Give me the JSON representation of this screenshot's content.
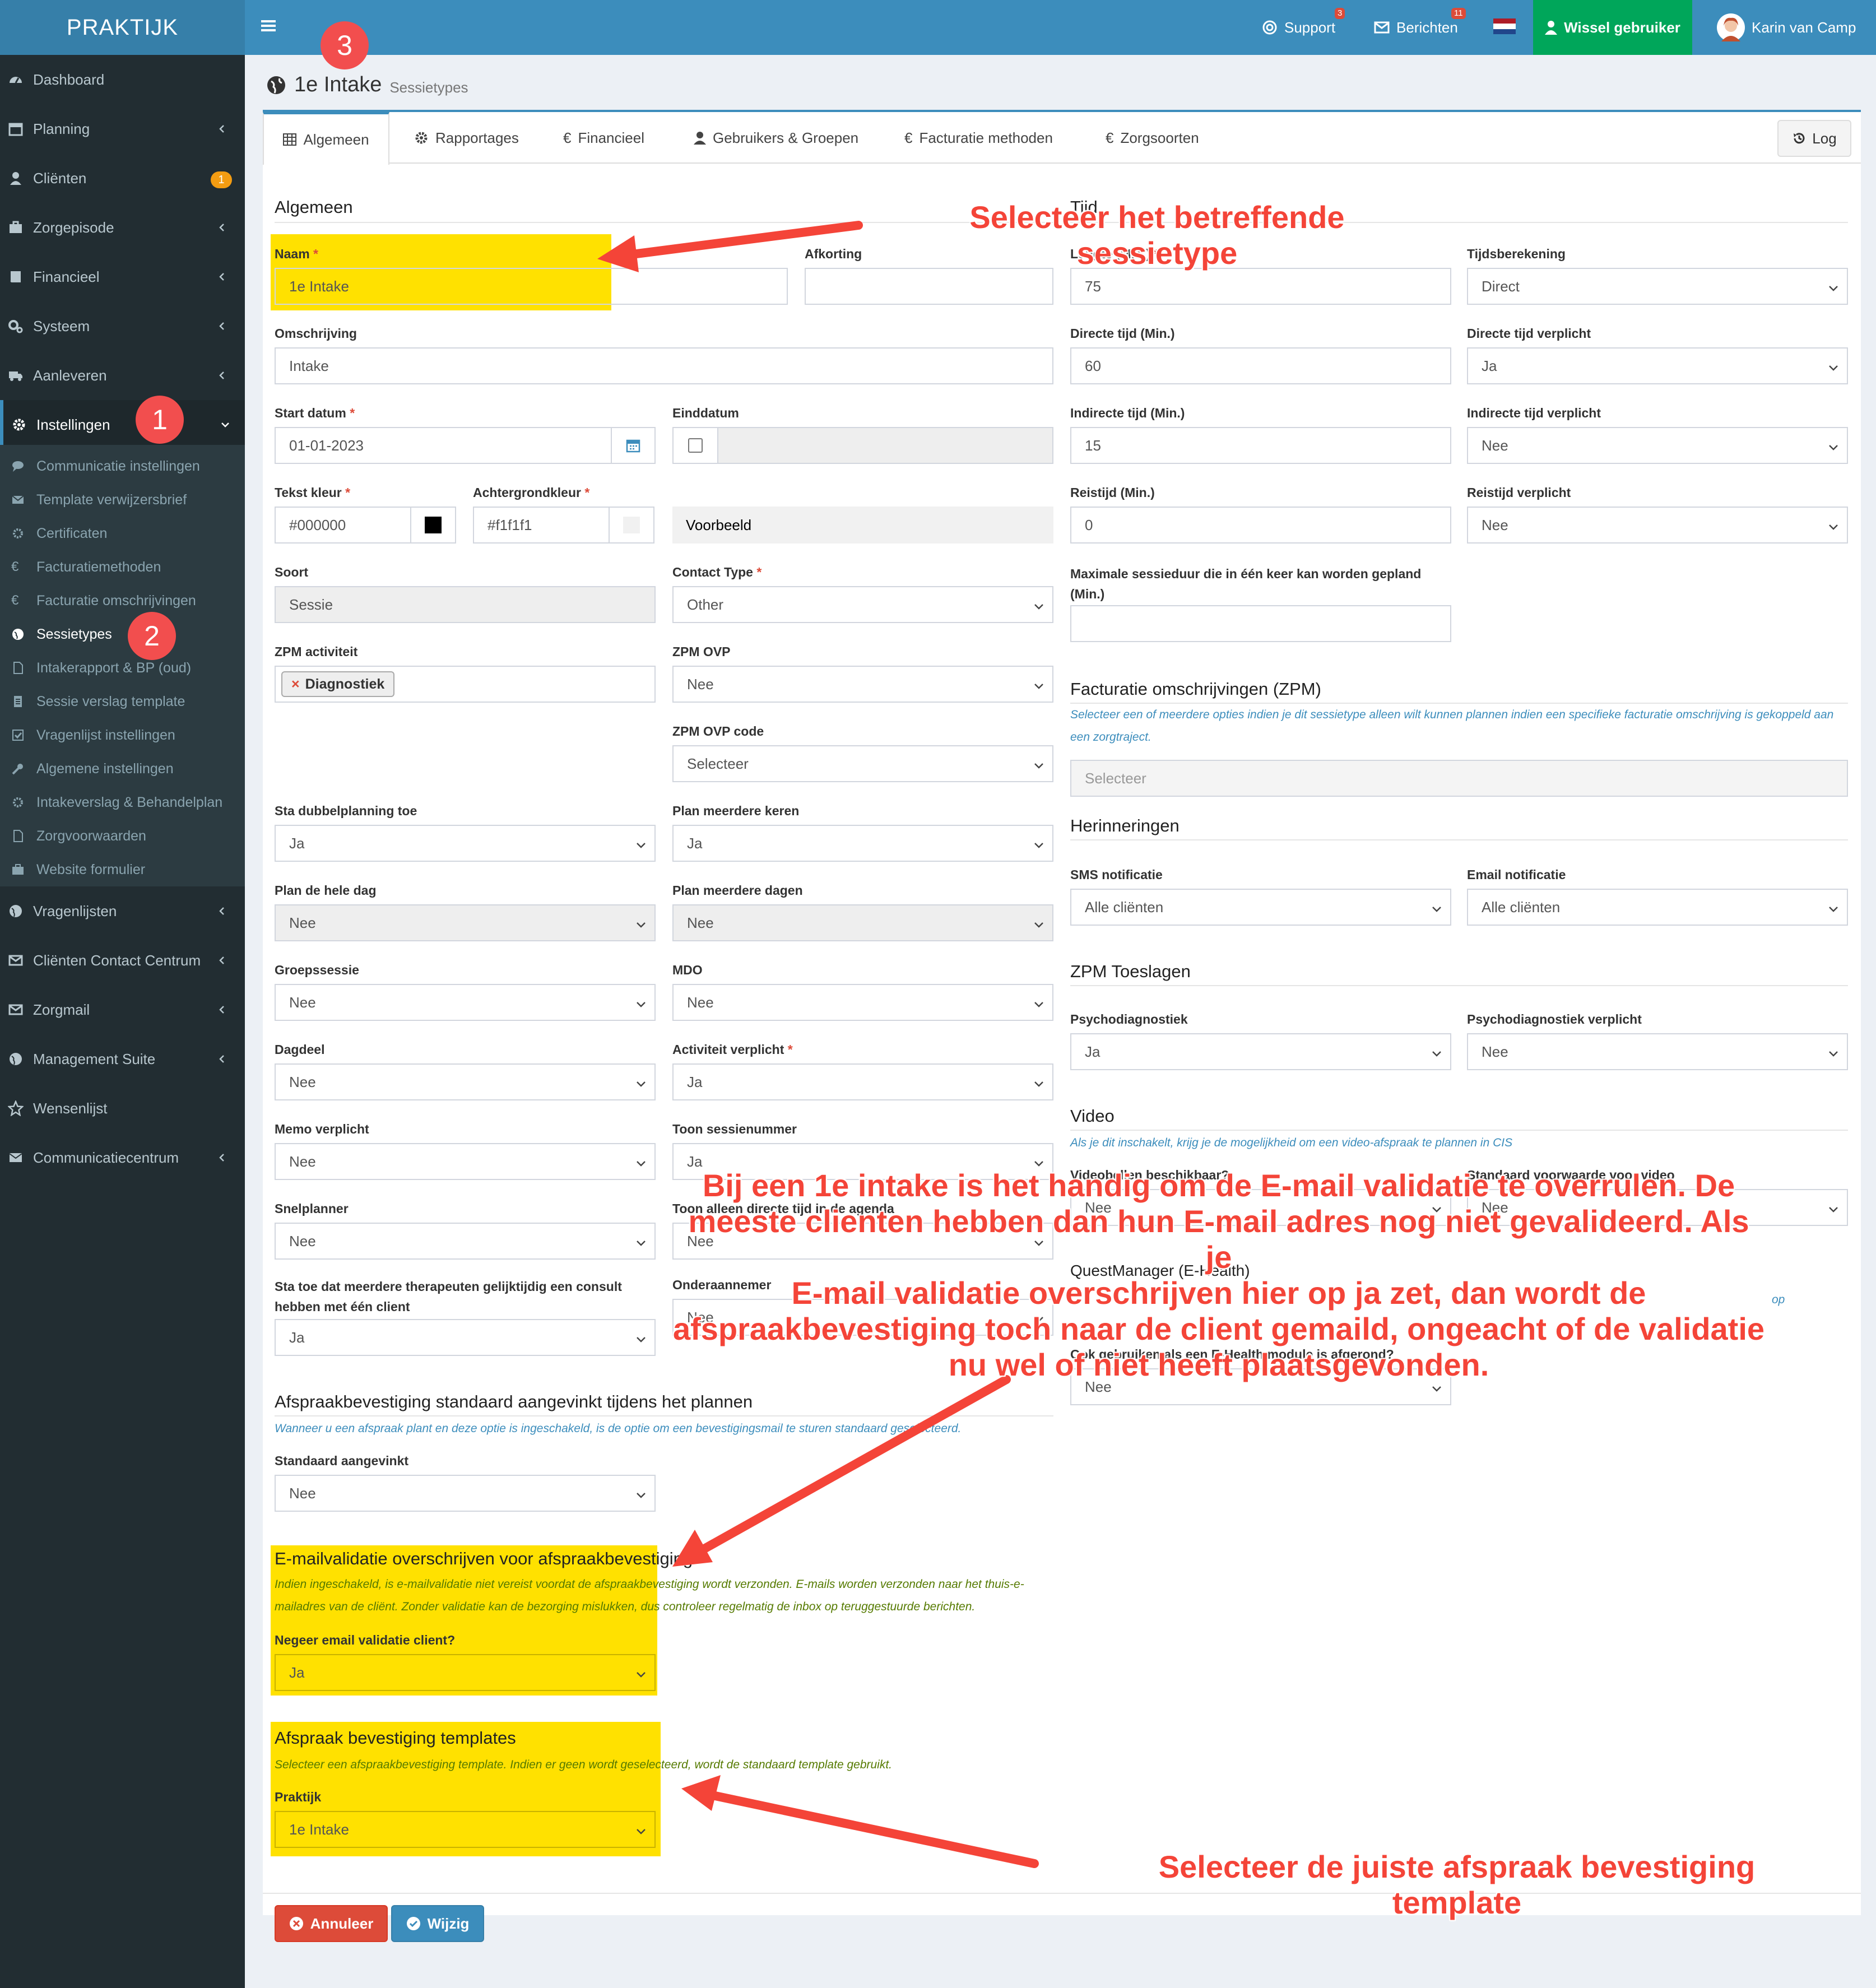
{
  "topbar": {
    "brand": "PRAKTIJK",
    "support_label": "Support",
    "support_badge": "3",
    "berichten_label": "Berichten",
    "berichten_badge": "11",
    "wissel_label": "Wissel gebruiker",
    "user_name": "Karin van Camp"
  },
  "sidebar": {
    "items": [
      {
        "label": "Dashboard",
        "icon": "dashboard-icon"
      },
      {
        "label": "Planning",
        "icon": "calendar-icon"
      },
      {
        "label": "Cliënten",
        "icon": "user-icon",
        "badge": "1"
      },
      {
        "label": "Zorgepisode",
        "icon": "briefcase-icon"
      },
      {
        "label": "Financieel",
        "icon": "book-icon"
      },
      {
        "label": "Systeem",
        "icon": "cogs-icon"
      },
      {
        "label": "Aanleveren",
        "icon": "truck-icon"
      },
      {
        "label": "Instellingen",
        "icon": "gear-icon"
      },
      {
        "label": "Vragenlijsten",
        "icon": "globe-icon"
      },
      {
        "label": "Cliënten Contact Centrum",
        "icon": "envelope-icon"
      },
      {
        "label": "Zorgmail",
        "icon": "envelope-icon"
      },
      {
        "label": "Management Suite",
        "icon": "globe-icon"
      },
      {
        "label": "Wensenlijst",
        "icon": "star-icon"
      },
      {
        "label": "Communicatiecentrum",
        "icon": "envelope-icon"
      }
    ],
    "submenu": [
      "Communicatie instellingen",
      "Template verwijzersbrief",
      "Certificaten",
      "Facturatiemethoden",
      "Facturatie omschrijvingen",
      "Sessietypes",
      "Intakerapport & BP (oud)",
      "Sessie verslag template",
      "Vragenlijst instellingen",
      "Algemene instellingen",
      "Intakeverslag & Behandelplan",
      "Zorgvoorwaarden",
      "Website formulier"
    ]
  },
  "page": {
    "title": "1e Intake",
    "subtitle": "Sessietypes"
  },
  "tabs": [
    "Algemeen",
    "Rapportages",
    "Financieel",
    "Gebruikers & Groepen",
    "Facturatie methoden",
    "Zorgsoorten"
  ],
  "log_label": "Log",
  "sections": {
    "algemeen": "Algemeen",
    "tijd": "Tijd",
    "facturatie": "Facturatie omschrijvingen (ZPM)",
    "herinneringen": "Herinneringen",
    "toeslagen": "ZPM Toeslagen",
    "video": "Video",
    "afspraakbevestiging": "Afspraakbevestiging standaard aangevinkt tijdens het plannen",
    "emailvalidatie": "E-mailvalidatie overschrijven voor afspraakbevestiging",
    "templates": "Afspraak bevestiging templates"
  },
  "help": {
    "facturatie": "Selecteer een of meerdere opties indien je dit sessietype alleen wilt kunnen plannen indien een specifieke facturatie omschrijving is gekoppeld aan een zorgtraject.",
    "video": "Als je dit inschakelt, krijg je de mogelijkheid om een video-afspraak te plannen in CIS",
    "afspraak": "Wanneer u een afspraak plant en deze optie is ingeschakeld, is de optie om een bevestigingsmail te sturen standaard geselecteerd.",
    "email": "Indien ingeschakeld, is e-mailvalidatie niet vereist voordat de afspraakbevestiging wordt verzonden. E-mails worden verzonden naar het thuis-e-mailadres van de cliënt. Zonder validatie kan de bezorging mislukken, dus controleer regelmatig de inbox op teruggestuurde berichten.",
    "templates": "Selecteer een afspraakbevestiging template. Indien er geen wordt geselecteerd, wordt de standaard template gebruikt.",
    "questmanager_tail": "op"
  },
  "fields": {
    "naam": {
      "label": "Naam",
      "value": "1e Intake"
    },
    "afkorting": {
      "label": "Afkorting",
      "value": ""
    },
    "omschrijving": {
      "label": "Omschrijving",
      "value": "Intake"
    },
    "start": {
      "label": "Start datum",
      "value": "01-01-2023"
    },
    "eind": {
      "label": "Einddatum"
    },
    "tekstkleur": {
      "label": "Tekst kleur",
      "value": "#000000"
    },
    "achtergrond": {
      "label": "Achtergrondkleur",
      "value": "#f1f1f1"
    },
    "voorbeeld": "Voorbeeld",
    "soort": {
      "label": "Soort",
      "value": "Sessie"
    },
    "contacttype": {
      "label": "Contact Type",
      "value": "Other"
    },
    "zpm_act": {
      "label": "ZPM activiteit",
      "tag": "Diagnostiek"
    },
    "zpm_ovp": {
      "label": "ZPM OVP",
      "value": "Nee"
    },
    "zpm_ovp_code": {
      "label": "ZPM OVP code",
      "value": "Selecteer"
    },
    "dubbel": {
      "label": "Sta dubbelplanning toe",
      "value": "Ja"
    },
    "meerkeren": {
      "label": "Plan meerdere keren",
      "value": "Ja"
    },
    "heledag": {
      "label": "Plan de hele dag",
      "value": "Nee"
    },
    "meerdagen": {
      "label": "Plan meerdere dagen",
      "value": "Nee"
    },
    "groep": {
      "label": "Groepssessie",
      "value": "Nee"
    },
    "mdo": {
      "label": "MDO",
      "value": "Nee"
    },
    "dagdeel": {
      "label": "Dagdeel",
      "value": "Nee"
    },
    "actverplicht": {
      "label": "Activiteit verplicht",
      "value": "Ja"
    },
    "memo": {
      "label": "Memo verplicht",
      "value": "Nee"
    },
    "sessienr": {
      "label": "Toon sessienummer",
      "value": "Ja"
    },
    "snel": {
      "label": "Snelplanner",
      "value": "Nee"
    },
    "toonalleen": {
      "label": "Toon alleen directe tijd in de agenda",
      "value": "Nee"
    },
    "meerther": {
      "label": "Sta toe dat meerdere therapeuten gelijktijdig een consult hebben met één client",
      "value": "Ja"
    },
    "ondera": {
      "label": "Onderaannemer",
      "value": "Nee"
    },
    "lengte": {
      "label": "Lengte (Min.)",
      "value": "75"
    },
    "tijdsber": {
      "label": "Tijdsberekening",
      "value": "Direct"
    },
    "direct": {
      "label": "Directe tijd (Min.)",
      "value": "60"
    },
    "directverp": {
      "label": "Directe tijd verplicht",
      "value": "Ja"
    },
    "indirect": {
      "label": "Indirecte tijd (Min.)",
      "value": "15"
    },
    "indirectverp": {
      "label": "Indirecte tijd verplicht",
      "value": "Nee"
    },
    "reis": {
      "label": "Reistijd (Min.)",
      "value": "0"
    },
    "reisverp": {
      "label": "Reistijd verplicht",
      "value": "Nee"
    },
    "maxduur": {
      "label1": "Maximale sessieduur die in één keer kan worden gepland",
      "label2": "(Min.)",
      "value": ""
    },
    "facturatie": {
      "placeholder": "Selecteer"
    },
    "sms": {
      "label": "SMS notificatie",
      "value": "Alle cliënten"
    },
    "email": {
      "label": "Email notificatie",
      "value": "Alle cliënten"
    },
    "psycho": {
      "label": "Psychodiagnostiek",
      "value": "Ja"
    },
    "psychoverp": {
      "label": "Psychodiagnostiek verplicht",
      "value": "Nee"
    },
    "videobeschik": {
      "label": "Videobellen beschikbaar?",
      "value": "Nee"
    },
    "videovoorw": {
      "label": "Standaard voorwaarde voor video",
      "value": "Nee"
    },
    "quest": {
      "label": "QuestManager (E-Health)"
    },
    "ookgebruik": {
      "label": "Ook gebruiken als een E-Health module is afgerond?",
      "value": "Nee"
    },
    "standaard": {
      "label": "Standaard aangevinkt",
      "value": "Nee"
    },
    "negeer": {
      "label": "Negeer email validatie client?",
      "value": "Ja"
    },
    "praktijk": {
      "label": "Praktijk",
      "value": "1e Intake"
    }
  },
  "buttons": {
    "cancel": "Annuleer",
    "save": "Wijzig"
  },
  "annotations": {
    "n1": "1",
    "n2": "2",
    "n3": "3",
    "a1": "Selecteer het betreffende sessietype",
    "a2": [
      "Bij een 1e intake is het handig om de E-mail validatie te overrulen. De",
      "meeste clienten hebben dan hun E-mail adres nog niet gevalideerd. Als je",
      "E-mail validatie overschrijven hier op ja zet, dan wordt de",
      "afspraakbevestiging toch naar de client gemaild, ongeacht of de validatie",
      "nu wel of niet heeft plaatsgevonden."
    ],
    "a3": "Selecteer de  juiste afspraak bevestiging template"
  },
  "colors": {
    "header": "#3c8dbc",
    "sidebar": "#222d32",
    "success": "#00a65a",
    "danger": "#dd4b39",
    "highlight": "#ffe100",
    "annotation": "#f44438"
  }
}
